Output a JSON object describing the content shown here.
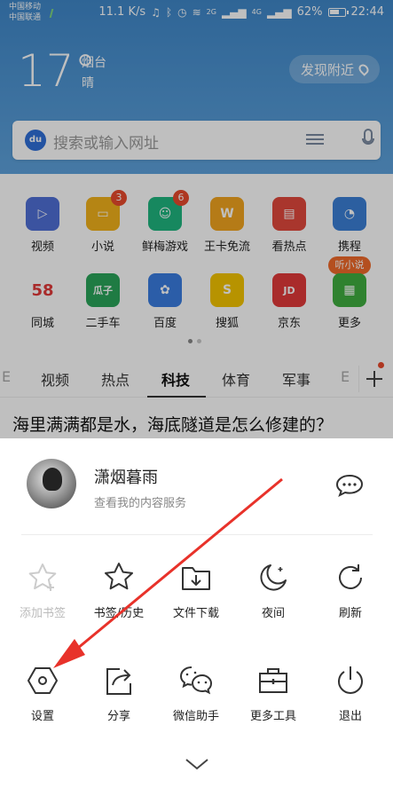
{
  "status_bar": {
    "carrier_1": "中国移动",
    "carrier_2": "中国联通",
    "speed": "11.1 K/s",
    "net_2g": "2G",
    "net_4g": "4G",
    "battery": "62%",
    "time": "22:44"
  },
  "weather": {
    "temperature": "17°",
    "city": "烟台",
    "condition": "晴",
    "nearby_button": "发现附近"
  },
  "search": {
    "logo": "du",
    "placeholder": "搜索或输入网址"
  },
  "apps": [
    {
      "label": "视频",
      "color": "#4f6fd6",
      "glyph": "▷"
    },
    {
      "label": "小说",
      "color": "#f2b21b",
      "glyph": "▭",
      "badge": "3"
    },
    {
      "label": "鲜梅游戏",
      "color": "#1fb67f",
      "glyph": "☺",
      "badge": "6"
    },
    {
      "label": "王卡免流",
      "color": "#f2a51f",
      "glyph": "W"
    },
    {
      "label": "看热点",
      "color": "#e2493c",
      "glyph": "▤"
    },
    {
      "label": "携程",
      "color": "#3b7fd6",
      "glyph": "◔"
    },
    {
      "label": "同城",
      "color": "#ffffff",
      "glyph": "58"
    },
    {
      "label": "二手车",
      "color": "#2aa55a",
      "glyph": "瓜子"
    },
    {
      "label": "百度",
      "color": "#3a7de0",
      "glyph": "✿"
    },
    {
      "label": "搜狐",
      "color": "#f5c400",
      "glyph": "S"
    },
    {
      "label": "京东",
      "color": "#e23a3a",
      "glyph": "JD"
    },
    {
      "label": "更多",
      "color": "#3fae3f",
      "glyph": "▦"
    }
  ],
  "listen_tag": "听小说",
  "tabs": {
    "items": [
      "E",
      "视频",
      "热点",
      "科技",
      "体育",
      "军事",
      "E"
    ],
    "active": "科技"
  },
  "headline": "海里满满都是水，海底隧道是怎么修建的？",
  "user": {
    "name": "潇烟暮雨",
    "subtitle": "查看我的内容服务"
  },
  "menu": {
    "add_bookmark": "添加书签",
    "bookmarks_history": "书签/历史",
    "downloads": "文件下载",
    "night": "夜间",
    "refresh": "刷新",
    "settings": "设置",
    "share": "分享",
    "wechat": "微信助手",
    "more_tools": "更多工具",
    "exit": "退出"
  },
  "colors": {
    "header_blue": "#4d94d2",
    "annotation_red": "#e8322a",
    "badge_red": "#e84a2c"
  }
}
